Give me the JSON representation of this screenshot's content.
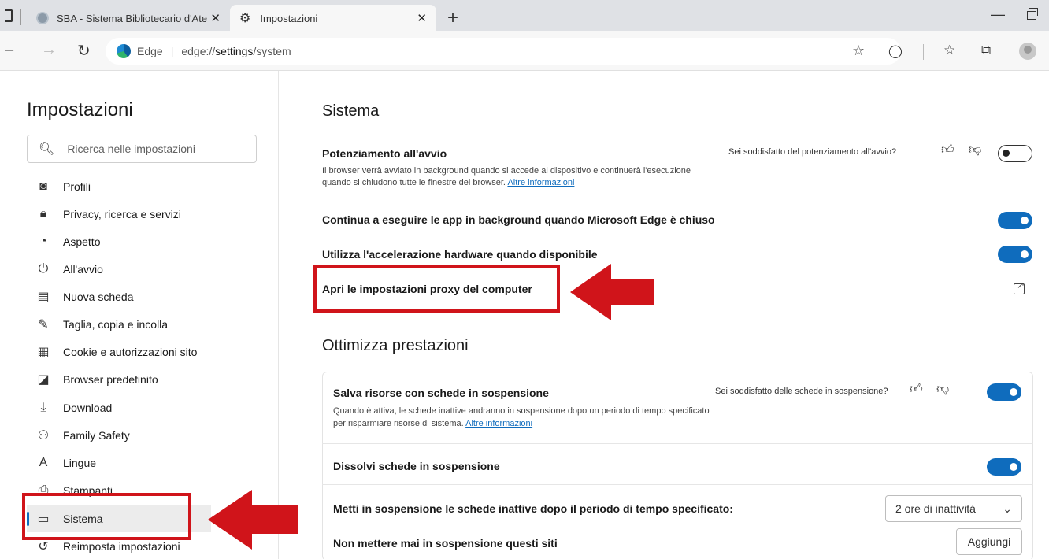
{
  "tabs": [
    {
      "title": "SBA - Sistema Bibliotecario d'Ate",
      "close": "✕"
    },
    {
      "title": "Impostazioni",
      "close": "✕"
    }
  ],
  "new_tab": "+",
  "address": {
    "browser": "Edge",
    "separator": "|",
    "url_prefix": "edge://",
    "url_bold": "settings",
    "url_suffix": "/system"
  },
  "sidebar": {
    "title": "Impostazioni",
    "search_placeholder": "Ricerca nelle impostazioni",
    "items": [
      {
        "label": "Profili",
        "icon": "profile-icon"
      },
      {
        "label": "Privacy, ricerca e servizi",
        "icon": "lock-icon"
      },
      {
        "label": "Aspetto",
        "icon": "palette-icon"
      },
      {
        "label": "All'avvio",
        "icon": "power-icon"
      },
      {
        "label": "Nuova scheda",
        "icon": "new-tab-icon"
      },
      {
        "label": "Taglia, copia e incolla",
        "icon": "clipboard-icon"
      },
      {
        "label": "Cookie e autorizzazioni sito",
        "icon": "cookie-icon"
      },
      {
        "label": "Browser predefinito",
        "icon": "default-browser-icon"
      },
      {
        "label": "Download",
        "icon": "download-icon"
      },
      {
        "label": "Family Safety",
        "icon": "family-icon"
      },
      {
        "label": "Lingue",
        "icon": "language-icon"
      },
      {
        "label": "Stampanti",
        "icon": "printer-icon"
      },
      {
        "label": "Sistema",
        "icon": "system-icon"
      },
      {
        "label": "Reimposta impostazioni",
        "icon": "reset-icon"
      }
    ]
  },
  "main": {
    "title": "Sistema",
    "startup_boost": {
      "title": "Potenziamento all'avvio",
      "desc": "Il browser verrà avviato in background quando si accede al dispositivo e continuerà l'esecuzione quando si chiudono tutte le finestre del browser.",
      "link": "Altre informazioni",
      "feedback": "Sei soddisfatto del potenziamento all'avvio?",
      "enabled": false
    },
    "background_apps": {
      "title": "Continua a eseguire le app in background quando Microsoft Edge è chiuso",
      "enabled": true
    },
    "hardware_accel": {
      "title": "Utilizza l'accelerazione hardware quando disponibile",
      "enabled": true
    },
    "proxy": {
      "title": "Apri le impostazioni proxy del computer"
    },
    "perf_title": "Ottimizza prestazioni",
    "sleeping_tabs": {
      "title": "Salva risorse con schede in sospensione",
      "desc": "Quando è attiva, le schede inattive andranno in sospensione dopo un periodo di tempo specificato per risparmiare risorse di sistema.",
      "link": "Altre informazioni",
      "feedback": "Sei soddisfatto delle schede in sospensione?",
      "enabled": true
    },
    "fade_tabs": {
      "title": "Dissolvi schede in sospensione",
      "enabled": true
    },
    "sleep_after": {
      "title": "Metti in sospensione le schede inattive dopo il periodo di tempo specificato:",
      "value": "2 ore di inattività"
    },
    "never_sleep": {
      "title": "Non mettere mai in sospensione questi siti",
      "button": "Aggiungi"
    }
  },
  "colors": {
    "accent": "#0f6cbd",
    "annotation": "#d0141a"
  }
}
